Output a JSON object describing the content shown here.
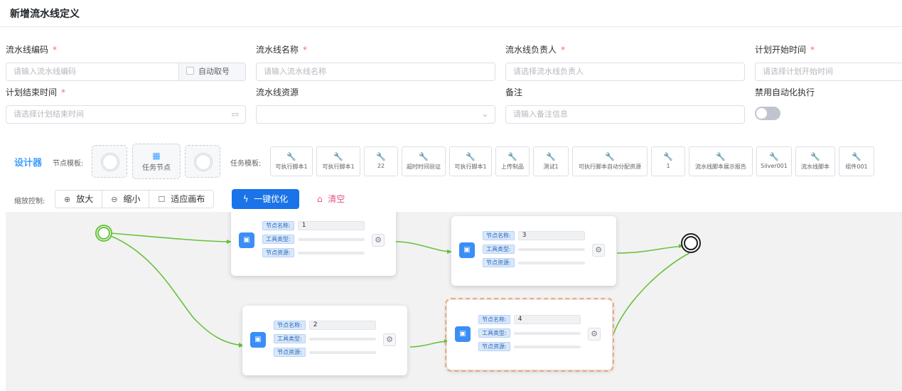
{
  "page": {
    "title": "新增流水线定义"
  },
  "form": {
    "code": {
      "label": "流水线编码",
      "required": "*",
      "placeholder": "请输入流水线编码",
      "auto_label": "自动取号"
    },
    "name": {
      "label": "流水线名称",
      "required": "*",
      "placeholder": "请输入流水线名称"
    },
    "owner": {
      "label": "流水线负责人",
      "required": "*",
      "placeholder": "请选择流水线负责人"
    },
    "start_time": {
      "label": "计划开始时间",
      "required": "*",
      "placeholder": "请选择计划开始时间"
    },
    "end_time": {
      "label": "计划结束时间",
      "required": "*",
      "placeholder": "请选择计划结束时间"
    },
    "resource": {
      "label": "流水线资源",
      "value": ""
    },
    "remark": {
      "label": "备注",
      "placeholder": "请输入备注信息"
    },
    "disable_auto": {
      "label": "禁用自动化执行",
      "enabled": false
    }
  },
  "designer": {
    "title": "设计器",
    "node_template_label": "节点模板:",
    "task_node_label": "任务节点",
    "job_template_label": "任务模板:",
    "job_templates": [
      "可执行脚本1",
      "可执行脚本1",
      "22",
      "超时时间验证",
      "可执行脚本1",
      "上传制品",
      "测试1",
      "可执行脚本自动分配资源",
      "1",
      "流水线脚本展示报告",
      "Silver001",
      "流水线脚本",
      "组件001"
    ],
    "zoom_label": "缩放控制:",
    "zoom_in": "放大",
    "zoom_out": "缩小",
    "fit": "适应画布",
    "optimize": "一键优化",
    "clear": "清空"
  },
  "canvas": {
    "field_labels": {
      "name": "节点名称:",
      "tool": "工具类型:",
      "resource": "节点资源:"
    },
    "nodes": [
      {
        "name": "1",
        "tool": "",
        "resource": "",
        "selected": false
      },
      {
        "name": "3",
        "tool": "",
        "resource": "",
        "selected": false
      },
      {
        "name": "2",
        "tool": "",
        "resource": "",
        "selected": false
      },
      {
        "name": "4",
        "tool": "",
        "resource": "",
        "selected": true
      }
    ],
    "colors": {
      "edge": "#67c23a",
      "start": "#67c23a",
      "end": "#1f1f1f",
      "selected": "#f0a97a",
      "accent": "#409eff"
    }
  }
}
